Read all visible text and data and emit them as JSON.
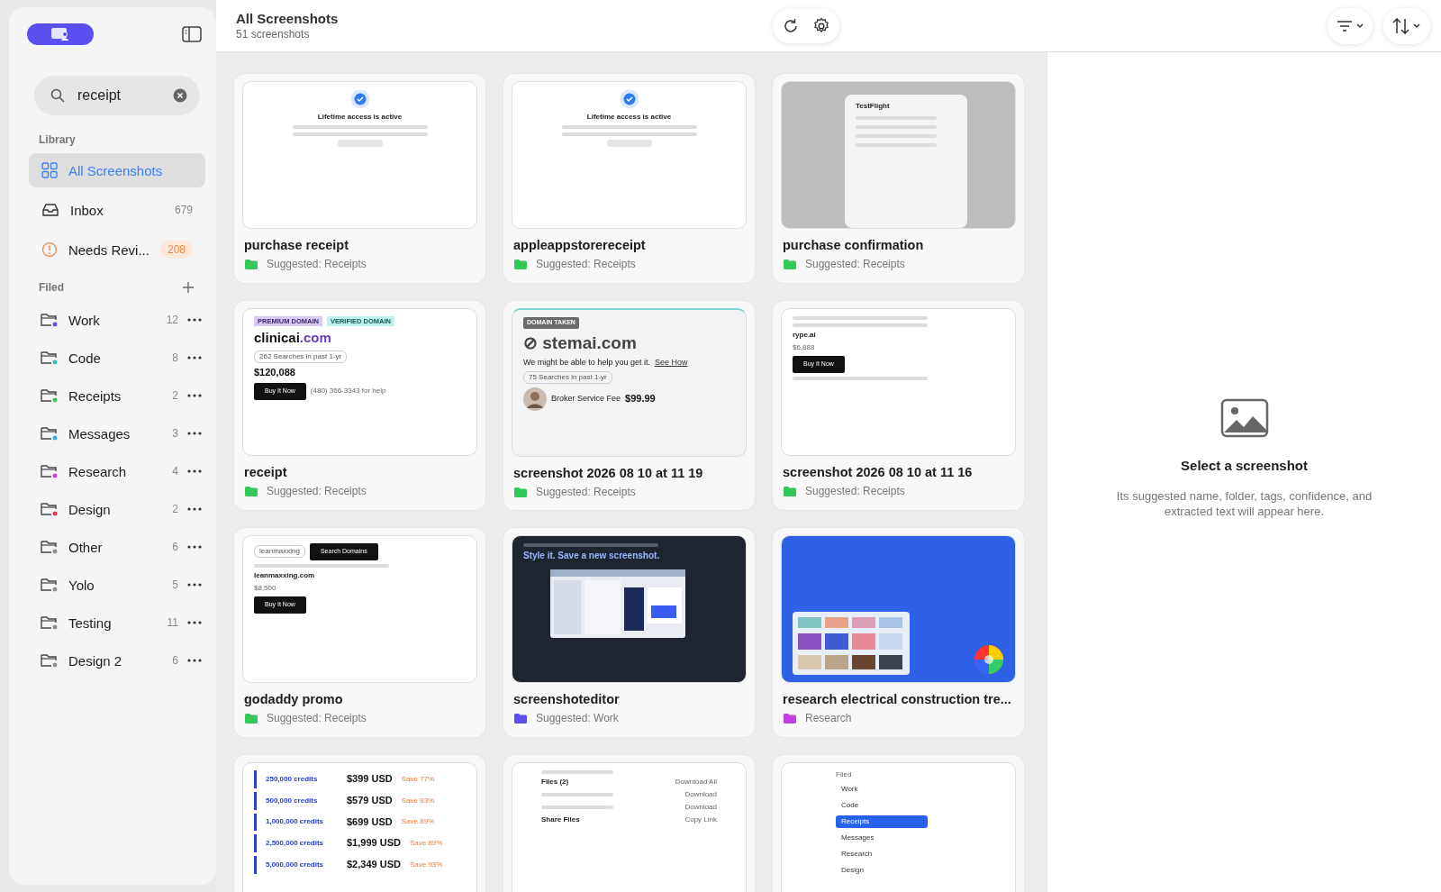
{
  "sidebar": {
    "search": {
      "value": "receipt"
    },
    "library_label": "Library",
    "library": [
      {
        "kind": "all",
        "label": "All Screenshots",
        "selected": true
      },
      {
        "kind": "inbox",
        "label": "Inbox",
        "count": "679",
        "selected": false
      },
      {
        "kind": "review",
        "label": "Needs Revi...",
        "count": "208",
        "selected": false
      }
    ],
    "filed_label": "Filed",
    "folders": [
      {
        "name": "Work",
        "count": "12",
        "color": "#5b4ff0"
      },
      {
        "name": "Code",
        "count": "8",
        "color": "#1ec6ad"
      },
      {
        "name": "Receipts",
        "count": "2",
        "color": "#34c759"
      },
      {
        "name": "Messages",
        "count": "3",
        "color": "#2ab0f2"
      },
      {
        "name": "Research",
        "count": "4",
        "color": "#c13fe0"
      },
      {
        "name": "Design",
        "count": "2",
        "color": "#ff2d55"
      },
      {
        "name": "Other",
        "count": "6",
        "color": "#8e8e93"
      },
      {
        "name": "Yolo",
        "count": "5",
        "color": "#8e8e93"
      },
      {
        "name": "Testing",
        "count": "11",
        "color": "#8e8e93"
      },
      {
        "name": "Design 2",
        "count": "6",
        "color": "#8e8e93"
      }
    ]
  },
  "header": {
    "title": "All Screenshots",
    "subtitle": "51 screenshots"
  },
  "cards": [
    {
      "title": "purchase receipt",
      "folder": "Suggested: Receipts",
      "color": "#34c759",
      "thumb": {
        "kind": "purchase",
        "lines": [
          {
            "parts": [
              {
                "kind": "check"
              }
            ]
          },
          {
            "parts": [
              {
                "kind": "body",
                "text": "Lifetime access is active"
              }
            ]
          },
          {
            "parts": [
              {
                "kind": "bar"
              }
            ]
          },
          {
            "parts": [
              {
                "kind": "bar"
              }
            ]
          },
          {
            "parts": [
              {
                "kind": "pill"
              }
            ]
          }
        ]
      }
    },
    {
      "title": "appleappstorereceipt",
      "folder": "Suggested: Receipts",
      "color": "#34c759",
      "thumb": {
        "kind": "purchase",
        "lines": [
          {
            "parts": [
              {
                "kind": "check"
              }
            ]
          },
          {
            "parts": [
              {
                "kind": "body",
                "text": "Lifetime access is active"
              }
            ]
          },
          {
            "parts": [
              {
                "kind": "bar"
              }
            ]
          },
          {
            "parts": [
              {
                "kind": "bar"
              }
            ]
          },
          {
            "parts": [
              {
                "kind": "pill"
              }
            ]
          }
        ]
      }
    },
    {
      "title": "purchase confirmation",
      "folder": "Suggested: Receipts",
      "color": "#34c759",
      "thumb": {
        "kind": "dialog",
        "lines": [
          {
            "parts": [
              {
                "kind": "body",
                "text": "TestFlight"
              }
            ]
          },
          {
            "parts": [
              {
                "kind": "bar"
              }
            ]
          },
          {
            "parts": [
              {
                "kind": "bar"
              }
            ]
          },
          {
            "parts": [
              {
                "kind": "bar"
              }
            ]
          },
          {
            "parts": [
              {
                "kind": "bar"
              }
            ]
          }
        ]
      }
    },
    {
      "title": "receipt",
      "folder": "Suggested: Receipts",
      "color": "#34c759",
      "thumb": {
        "kind": "domain",
        "lines": [
          {
            "parts": [
              {
                "kind": "badge",
                "text": "PREMIUM DOMAIN"
              },
              {
                "kind": "vbadge",
                "text": "VERIFIED DOMAIN"
              }
            ]
          },
          {
            "parts": [
              {
                "kind": "domain",
                "text": "clinicai"
              },
              {
                "kind": "accent",
                "text": ".com"
              }
            ]
          },
          {
            "parts": [
              {
                "kind": "chip",
                "text": "262 Searches in past 1-yr"
              }
            ]
          },
          {
            "parts": [
              {
                "kind": "price",
                "text": "$120,088"
              }
            ]
          },
          {
            "parts": [
              {
                "kind": "button",
                "text": "Buy It Now"
              },
              {
                "kind": "small",
                "text": "(480) 366-3343 for help"
              }
            ]
          }
        ]
      }
    },
    {
      "title": "screenshot 2026 08 10 at 11 19",
      "folder": "Suggested: Receipts",
      "color": "#34c759",
      "thumb": {
        "kind": "taken",
        "lines": [
          {
            "parts": [
              {
                "kind": "tag",
                "text": "DOMAIN TAKEN"
              }
            ]
          },
          {
            "parts": [
              {
                "kind": "domain",
                "text": "⊘ stemai.com"
              }
            ]
          },
          {
            "parts": [
              {
                "kind": "body",
                "text": "We might be able to help you get it."
              },
              {
                "kind": "link",
                "text": "See How"
              }
            ]
          },
          {
            "parts": [
              {
                "kind": "chip",
                "text": "75 Searches in past 1-yr"
              }
            ]
          },
          {
            "parts": [
              {
                "kind": "avatar"
              },
              {
                "kind": "body",
                "text": "Broker Service Fee"
              },
              {
                "kind": "price",
                "text": "$99.99"
              }
            ]
          }
        ]
      }
    },
    {
      "title": "screenshot 2026 08 10 at 11 16",
      "folder": "Suggested: Receipts",
      "color": "#34c759",
      "thumb": {
        "kind": "domain",
        "lines": [
          {
            "parts": [
              {
                "kind": "bar"
              }
            ]
          },
          {
            "parts": [
              {
                "kind": "bar"
              }
            ]
          },
          {
            "parts": [
              {
                "kind": "body",
                "text": "rype.ai"
              }
            ]
          },
          {
            "parts": [
              {
                "kind": "small",
                "text": "$6,888"
              }
            ]
          },
          {
            "parts": [
              {
                "kind": "button",
                "text": "Buy It Now"
              }
            ]
          },
          {
            "parts": [
              {
                "kind": "bar"
              }
            ]
          }
        ]
      }
    },
    {
      "title": "godaddy promo",
      "folder": "Suggested: Receipts",
      "color": "#34c759",
      "thumb": {
        "kind": "domain",
        "lines": [
          {
            "parts": [
              {
                "kind": "chip",
                "text": "leanmaxxing"
              },
              {
                "kind": "button",
                "text": "Search Domains"
              }
            ]
          },
          {
            "parts": [
              {
                "kind": "bar"
              }
            ]
          },
          {
            "parts": [
              {
                "kind": "body",
                "text": "leanmaxxing.com"
              }
            ]
          },
          {
            "parts": [
              {
                "kind": "small",
                "text": "$8,500"
              }
            ]
          },
          {
            "parts": [
              {
                "kind": "button",
                "text": "Buy It Now"
              }
            ]
          }
        ]
      }
    },
    {
      "title": "screenshoteditor",
      "folder": "Suggested: Work",
      "color": "#5b4ff0",
      "thumb": {
        "kind": "editor",
        "lines": [
          {
            "parts": [
              {
                "kind": "bar"
              }
            ]
          },
          {
            "parts": [
              {
                "kind": "body",
                "text": "Style it. Save a new screenshot."
              }
            ]
          },
          {
            "parts": [
              {
                "kind": "panel"
              }
            ]
          }
        ]
      }
    },
    {
      "title": "research electrical construction tre...",
      "folder": "Research",
      "color": "#c13fe0",
      "thumb": {
        "kind": "research",
        "lines": [
          {
            "parts": [
              {
                "kind": "swatches"
              }
            ]
          },
          {
            "parts": [
              {
                "kind": "wheel"
              }
            ]
          }
        ]
      }
    },
    {
      "thumb": {
        "kind": "credits",
        "lines": [
          {
            "parts": [
              {
                "kind": "credit",
                "text": "250,000 credits"
              },
              {
                "kind": "price",
                "text": "$399 USD"
              },
              {
                "kind": "save",
                "text": "Save 77%"
              }
            ]
          },
          {
            "parts": [
              {
                "kind": "credit",
                "text": "500,000 credits"
              },
              {
                "kind": "price",
                "text": "$579 USD"
              },
              {
                "kind": "save",
                "text": "Save 83%"
              }
            ]
          },
          {
            "parts": [
              {
                "kind": "credit",
                "text": "1,000,000 credits"
              },
              {
                "kind": "price",
                "text": "$699 USD"
              },
              {
                "kind": "save",
                "text": "Save 89%"
              }
            ]
          },
          {
            "parts": [
              {
                "kind": "credit",
                "text": "2,500,000 credits"
              },
              {
                "kind": "price",
                "text": "$1,999 USD"
              },
              {
                "kind": "save",
                "text": "Save 89%"
              }
            ]
          },
          {
            "parts": [
              {
                "kind": "credit",
                "text": "5,000,000 credits"
              },
              {
                "kind": "price",
                "text": "$2,349 USD"
              },
              {
                "kind": "save",
                "text": "Save 93%"
              }
            ]
          }
        ]
      }
    },
    {
      "thumb": {
        "kind": "files",
        "lines": [
          {
            "parts": [
              {
                "kind": "bar"
              }
            ]
          },
          {
            "parts": [
              {
                "kind": "body",
                "text": "Files (2)"
              },
              {
                "kind": "small",
                "text": "Download All"
              }
            ]
          },
          {
            "parts": [
              {
                "kind": "bar"
              },
              {
                "kind": "small",
                "text": "Download"
              }
            ]
          },
          {
            "parts": [
              {
                "kind": "bar"
              },
              {
                "kind": "small",
                "text": "Download"
              }
            ]
          },
          {
            "parts": [
              {
                "kind": "body",
                "text": "Share Files"
              },
              {
                "kind": "small",
                "text": "Copy Link"
              }
            ]
          }
        ]
      }
    },
    {
      "thumb": {
        "kind": "folders",
        "lines": [
          {
            "parts": [
              {
                "kind": "small",
                "text": "Filed"
              }
            ]
          },
          {
            "parts": [
              {
                "kind": "item",
                "text": "Work"
              }
            ]
          },
          {
            "parts": [
              {
                "kind": "item",
                "text": "Code"
              }
            ]
          },
          {
            "parts": [
              {
                "kind": "selitem",
                "text": "Receipts"
              }
            ]
          },
          {
            "parts": [
              {
                "kind": "item",
                "text": "Messages"
              }
            ]
          },
          {
            "parts": [
              {
                "kind": "item",
                "text": "Research"
              }
            ]
          },
          {
            "parts": [
              {
                "kind": "item",
                "text": "Design"
              }
            ]
          }
        ]
      }
    }
  ],
  "detail": {
    "title": "Select a screenshot",
    "text": "Its suggested name, folder, tags, confidence, and extracted text will appear here."
  }
}
